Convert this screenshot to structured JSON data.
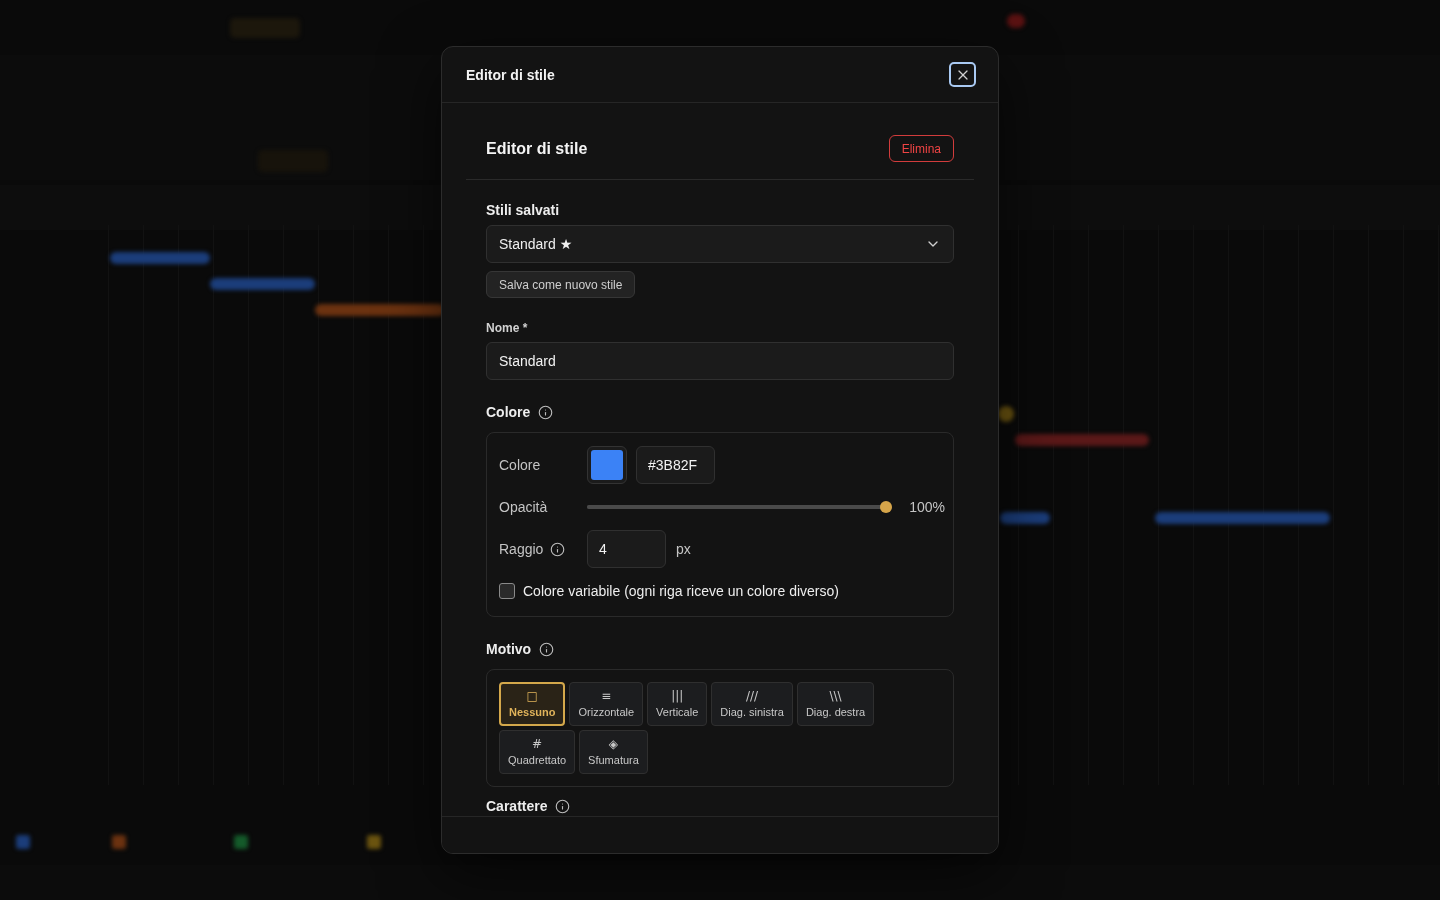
{
  "dialog": {
    "title": "Editor di stile"
  },
  "editor": {
    "heading": "Editor di stile",
    "delete_button": "Elimina"
  },
  "saved_styles": {
    "label": "Stili salvati",
    "value": "Standard ★",
    "save_button": "Salva come nuovo stile"
  },
  "name_field": {
    "label": "Nome *",
    "value": "Standard"
  },
  "color_section": {
    "title": "Colore",
    "info": true,
    "rows": [
      {
        "kind": "color",
        "label": "Colore",
        "info": false,
        "color": "#3b82f6",
        "value": "#3B82F"
      },
      {
        "kind": "slider",
        "label": "Opacità",
        "info": false,
        "level": 1,
        "reading": "100%"
      },
      {
        "kind": "number",
        "label": "Raggio",
        "info": true,
        "value": "4",
        "unit": "px"
      },
      {
        "kind": "checkbox",
        "label": "Colore variabile (ogni riga riceve un colore diverso)",
        "info": false,
        "checked": false
      }
    ]
  },
  "pattern_section": {
    "title": "Motivo",
    "info": true,
    "options": [
      {
        "glyph": "□",
        "label": "Nessuno",
        "selected": true
      },
      {
        "glyph": "≡",
        "label": "Orizzontale",
        "selected": false
      },
      {
        "glyph": "|||",
        "label": "Verticale",
        "selected": false
      },
      {
        "glyph": "///",
        "label": "Diag. sinistra",
        "selected": false
      },
      {
        "glyph": "\\\\\\",
        "label": "Diag. destra",
        "selected": false
      },
      {
        "glyph": "#",
        "label": "Quadrettato",
        "selected": false
      },
      {
        "glyph": "◈",
        "label": "Sfumatura",
        "selected": false
      }
    ]
  },
  "font_section": {
    "title": "Carattere",
    "info": true
  }
}
